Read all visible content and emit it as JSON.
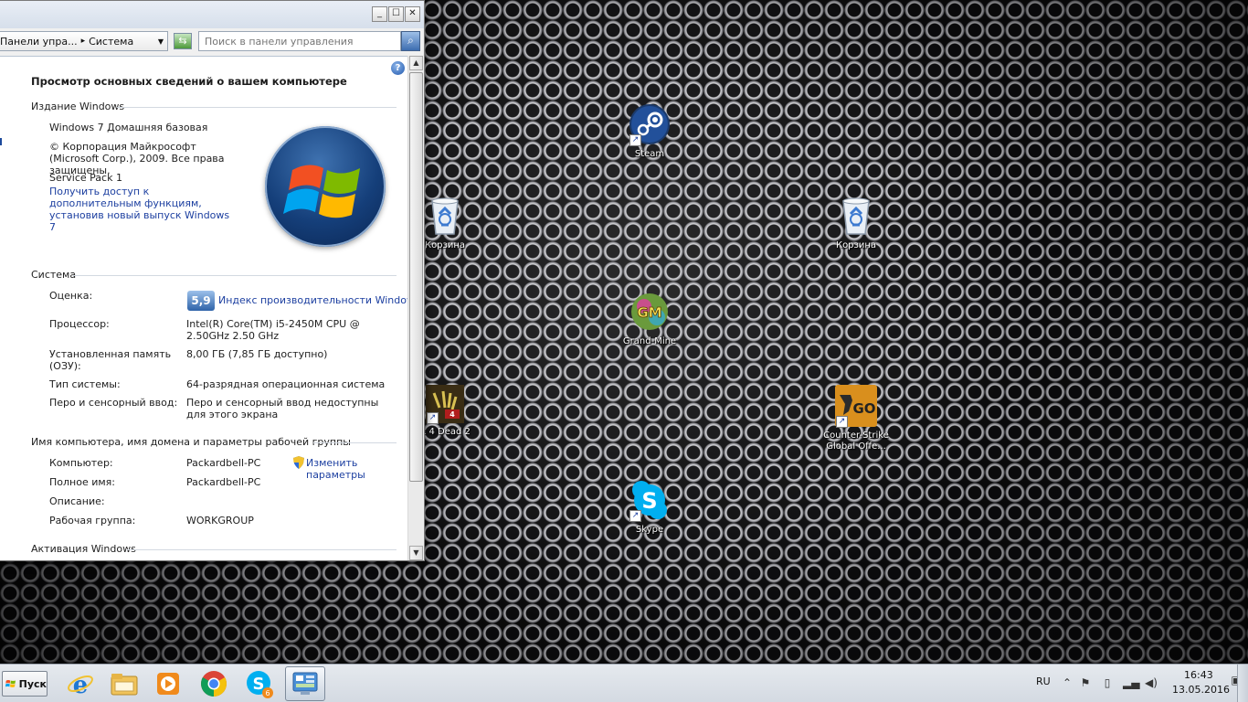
{
  "window": {
    "controls": {
      "minimize": "_",
      "maximize": "☐",
      "close": "✕"
    },
    "breadcrumb": {
      "parent": "Панели упра...",
      "current": "Система"
    },
    "search_placeholder": "Поиск в панели управления",
    "page_title": "Просмотр основных сведений о вашем компьютере",
    "edition": {
      "heading": "Издание Windows",
      "name": "Windows 7 Домашняя базовая",
      "copyright": "© Корпорация Майкрософт (Microsoft Corp.), 2009. Все права защищены.",
      "service_pack": "Service Pack 1",
      "upgrade_link": "Получить доступ к дополнительным функциям, установив новый выпуск Windows 7"
    },
    "system": {
      "heading": "Система",
      "rating_label": "Оценка:",
      "rating_score": "5,9",
      "rating_link": "Индекс производительности Windows",
      "cpu_label": "Процессор:",
      "cpu_value": "Intel(R) Core(TM) i5-2450M CPU @ 2.50GHz 2.50 GHz",
      "ram_label": "Установленная память (ОЗУ):",
      "ram_value": "8,00 ГБ (7,85 ГБ доступно)",
      "type_label": "Тип системы:",
      "type_value": "64-разрядная операционная система",
      "pen_label": "Перо и сенсорный ввод:",
      "pen_value": "Перо и сенсорный ввод недоступны для этого экрана"
    },
    "computer": {
      "heading": "Имя компьютера, имя домена и параметры рабочей группы",
      "name_label": "Компьютер:",
      "name_value": "Packardbell-PC",
      "full_label": "Полное имя:",
      "full_value": "Packardbell-PC",
      "desc_label": "Описание:",
      "desc_value": "",
      "group_label": "Рабочая группа:",
      "group_value": "WORKGROUP",
      "change_link": "Изменить параметры"
    },
    "activation": {
      "heading": "Активация Windows"
    }
  },
  "desktop": {
    "icons": [
      {
        "label": "Steam",
        "icon": "steam-icon"
      },
      {
        "label": "Корзина",
        "icon": "recycle-bin-icon"
      },
      {
        "label": "Корзина",
        "icon": "recycle-bin-icon"
      },
      {
        "label": "Grand-Mine",
        "icon": "grand-mine-icon"
      },
      {
        "label": "ft 4 Dead 2",
        "icon": "left4dead-icon"
      },
      {
        "label": "Counter-Strike Global Offe...",
        "icon": "csgo-icon"
      },
      {
        "label": "Skype",
        "icon": "skype-icon"
      }
    ]
  },
  "taskbar": {
    "start_label": "Пуск",
    "apps": [
      "ie-icon",
      "explorer-icon",
      "media-player-icon",
      "chrome-icon",
      "skype-icon",
      "control-panel-icon"
    ],
    "skype_badge": "6",
    "lang": "RU",
    "time": "16:43",
    "date": "13.05.2016"
  },
  "colors": {
    "link": "#1c3fa0",
    "taskbar": "#dfe4ea",
    "window_bg": "#ffffff"
  }
}
